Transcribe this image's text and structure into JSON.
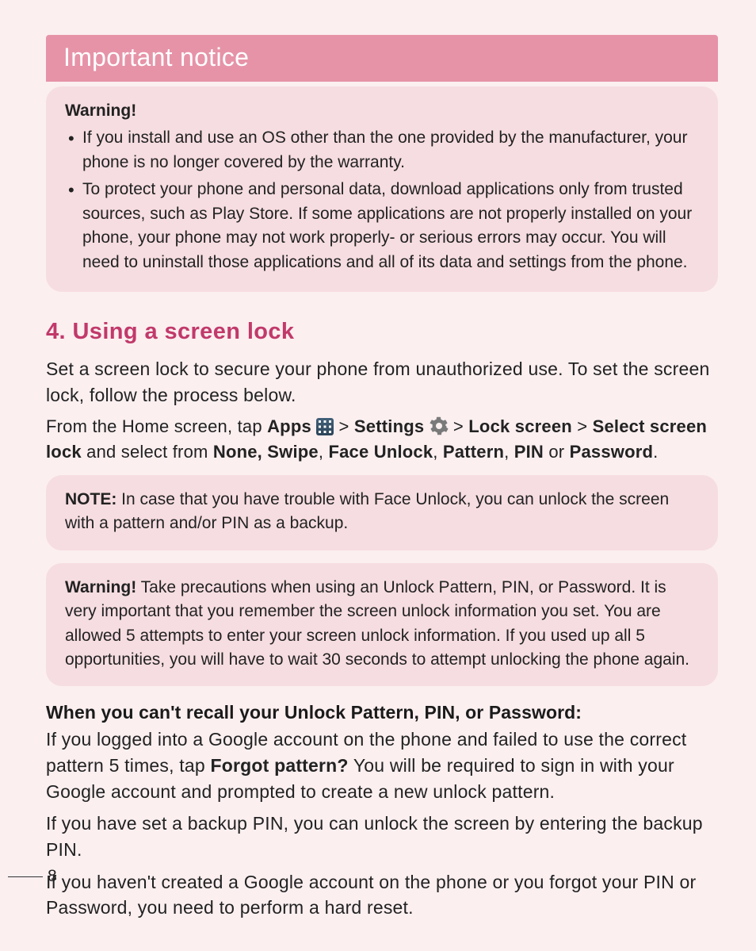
{
  "title": "Important notice",
  "warning_box_1": {
    "heading": "Warning!",
    "bullets": [
      "If you install and use an OS other than the one provided by the manufacturer, your phone is no longer covered by the warranty.",
      "To protect your phone and personal data, download applications only from trusted sources, such as Play Store. If some applications are not properly installed on your phone, your phone may not work properly- or serious errors may occur. You will need to uninstall those applications and all of its data and settings from the phone."
    ]
  },
  "section_heading": "4. Using a screen lock",
  "p_intro": "Set a screen lock to secure your phone from unauthorized use. To set the screen lock, follow the process below.",
  "nav": {
    "prefix": "From the Home screen, tap ",
    "apps": "Apps",
    "gt1": " > ",
    "settings": "Settings",
    "gt2": " > ",
    "lockscreen": "Lock screen",
    "gt3": " > ",
    "select": "Select screen lock",
    "middle": " and select from ",
    "opts1": "None, Swipe",
    "c1": ", ",
    "opts2": "Face Unlock",
    "c2": ", ",
    "opts3": "Pattern",
    "c3": ", ",
    "opts4": "PIN",
    "or": " or ",
    "opts5": "Password",
    "end": "."
  },
  "note_box": {
    "label": "NOTE:",
    "text": " In case that you have trouble with Face Unlock, you can unlock the screen with a pattern and/or PIN as a backup."
  },
  "warning_box_2": {
    "label": "Warning!",
    "text": " Take precautions when using an Unlock Pattern, PIN, or Password. It is very important that you remember the screen unlock information you set. You are allowed 5 attempts to enter your screen unlock information. If you used up all 5 opportunities, you will have to wait 30 seconds to attempt unlocking the phone again."
  },
  "subhead": "When you can't recall your Unlock Pattern, PIN, or Password:",
  "forgot": {
    "p1a": "If you logged into a Google account on the phone and failed to use the correct pattern 5 times, tap ",
    "bold": "Forgot pattern?",
    "p1b": " You will be required to sign in with your Google account and prompted to create a new unlock pattern.",
    "p2": "If you have set a backup PIN, you can unlock the screen by entering the backup PIN.",
    "p3": "If you haven't created a Google account on the phone or you forgot your PIN or Password, you need to perform a hard reset."
  },
  "page_number": "8"
}
